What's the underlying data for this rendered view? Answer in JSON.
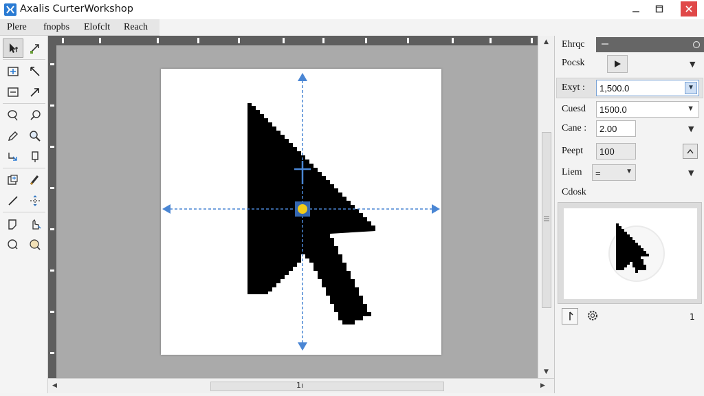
{
  "window": {
    "title": "Axalis CurterWorkshop"
  },
  "menu": {
    "items": [
      "Plere",
      "fnopbs",
      "Elofclt",
      "Reach"
    ]
  },
  "tools": {
    "icons": [
      "cursor-select-icon",
      "arrow-pen-icon",
      "add-frame-icon",
      "line-arrow-icon",
      "frame-edit-icon",
      "arrow-diagonal-icon",
      "lasso-icon",
      "magic-wand-icon",
      "pencil-icon",
      "zoom-icon",
      "rotate-icon",
      "eraser-icon",
      "layer-add-icon",
      "brush-icon",
      "line-icon",
      "move-arrows-icon",
      "hotspot-icon",
      "hand-pointer-icon",
      "ellipse-icon",
      "color-picker-icon"
    ]
  },
  "scrollbars": {
    "horizontal_marker": "1ı"
  },
  "panel": {
    "title": "Ehrqc",
    "rows": [
      {
        "label": "Pocsk"
      },
      {
        "label": "Exyt :",
        "value": "1,500.0"
      },
      {
        "label": "Cuesd",
        "value": "1500.0"
      },
      {
        "label": "Cane :",
        "value": "2.00"
      },
      {
        "label": "Peept",
        "value": "100"
      },
      {
        "label": "Liem",
        "value": "="
      }
    ],
    "preview_label": "Cdosk",
    "count": "1"
  },
  "colors": {
    "canvas_bg": "#aaaaaa",
    "guide": "#4a86d4",
    "hotspot_fill": "#f2cc1a",
    "hotspot_border": "#3466b0",
    "close_button": "#e04848",
    "logo": "#2a7bd3"
  }
}
